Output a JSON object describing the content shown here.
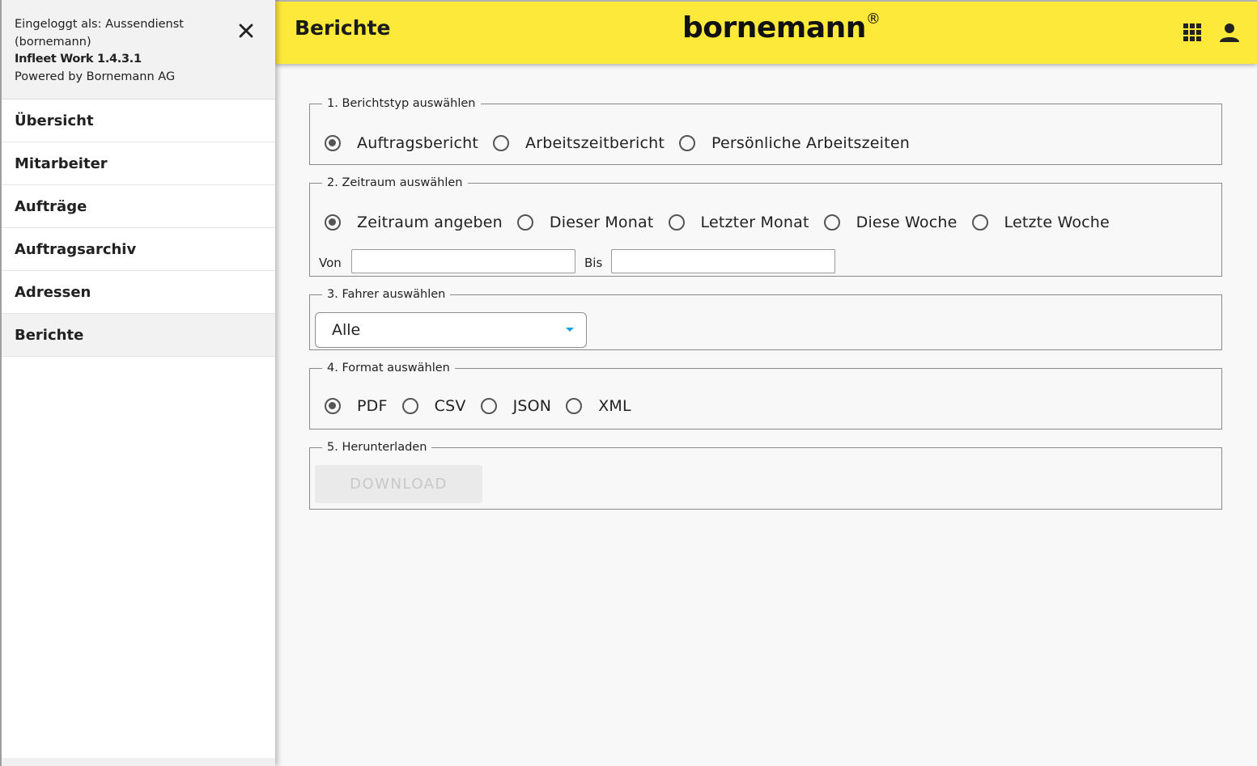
{
  "sidebar": {
    "login_line1": "Eingeloggt als: Aussendienst",
    "login_line2": "(bornemann)",
    "app_version": "Infleet Work 1.4.3.1",
    "powered_by": "Powered by Bornemann AG",
    "items": [
      {
        "label": "Übersicht",
        "active": false
      },
      {
        "label": "Mitarbeiter",
        "active": false
      },
      {
        "label": "Aufträge",
        "active": false
      },
      {
        "label": "Auftragsarchiv",
        "active": false
      },
      {
        "label": "Adressen",
        "active": false
      },
      {
        "label": "Berichte",
        "active": true
      }
    ]
  },
  "header": {
    "title": "Berichte",
    "logo": "bornemann",
    "logo_mark": "®",
    "bg_color": "#fde93a",
    "icons": [
      "apps-grid-icon",
      "account-icon"
    ]
  },
  "sections": {
    "report_type": {
      "legend": "1. Berichtstyp auswählen",
      "options": [
        "Auftragsbericht",
        "Arbeitszeitbericht",
        "Persönliche Arbeitszeiten"
      ],
      "selected": "Auftragsbericht"
    },
    "period": {
      "legend": "2. Zeitraum auswählen",
      "options": [
        "Zeitraum angeben",
        "Dieser Monat",
        "Letzter Monat",
        "Diese Woche",
        "Letzte Woche"
      ],
      "selected": "Zeitraum angeben",
      "from_label": "Von",
      "to_label": "Bis",
      "from_value": "",
      "to_value": ""
    },
    "driver": {
      "legend": "3. Fahrer auswählen",
      "selected": "Alle"
    },
    "format": {
      "legend": "4. Format auswählen",
      "options": [
        "PDF",
        "CSV",
        "JSON",
        "XML"
      ],
      "selected": "PDF"
    },
    "download": {
      "legend": "5. Herunterladen",
      "button_label": "DOWNLOAD"
    }
  }
}
